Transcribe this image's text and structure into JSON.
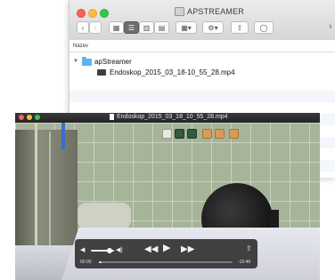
{
  "finder": {
    "title": "APSTREAMER",
    "column_header": "Název",
    "folder": {
      "name": "apStreamer"
    },
    "file": {
      "name": "Endoskop_2015_03_18-10_55_28.mp4"
    },
    "toolbar_icons": [
      "back-icon",
      "forward-icon",
      "icon-view-icon",
      "list-view-icon",
      "column-view-icon",
      "cover-flow-icon",
      "arrange-icon",
      "action-gear-icon",
      "share-icon",
      "tag-icon"
    ],
    "more_glyph": "›"
  },
  "player": {
    "title": "Endoskop_2015_03_18_10_55_28.mp4",
    "elapsed": "00:00",
    "remaining": "-10:46",
    "volume_level": 0.7,
    "progress": 0.0,
    "icons": [
      "volume-low-icon",
      "volume-high-icon",
      "rewind-icon",
      "play-icon",
      "fast-forward-icon",
      "share-icon"
    ]
  }
}
